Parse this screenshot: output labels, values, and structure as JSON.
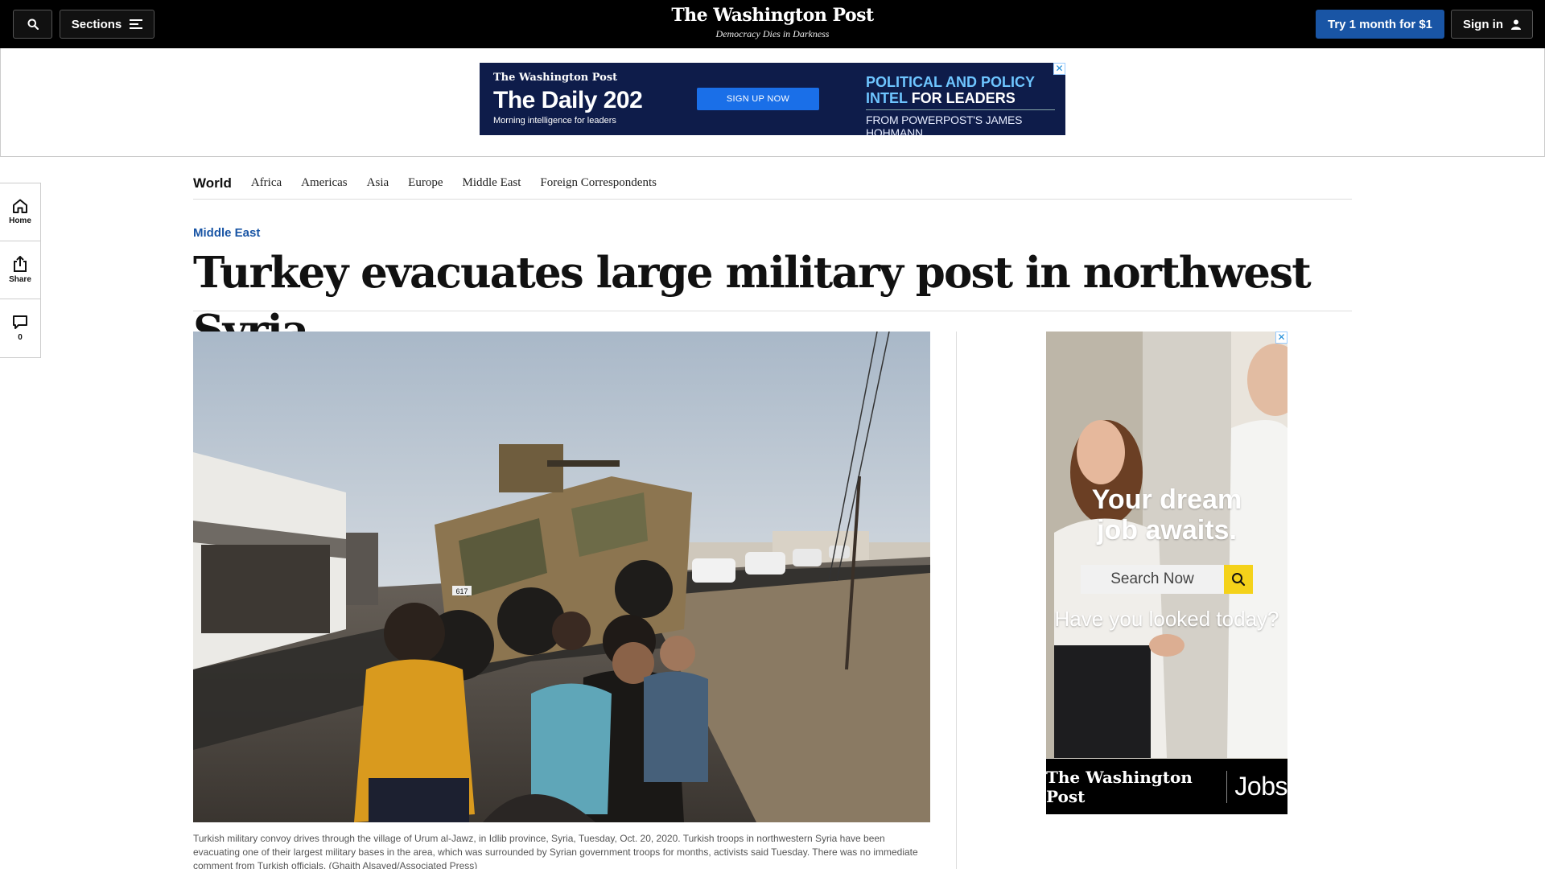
{
  "header": {
    "sections_label": "Sections",
    "logo": "The Washington Post",
    "tagline": "Democracy Dies in Darkness",
    "trial_label": "Try 1 month for $1",
    "signin_label": "Sign in"
  },
  "banner_ad": {
    "logo": "The Washington Post",
    "title": "The Daily 202",
    "subtitle": "Morning intelligence for leaders",
    "cta": "SIGN UP NOW",
    "headline_blue": "POLITICAL AND POLICY",
    "headline_line2_blue": "INTEL",
    "headline_line2_white": "FOR LEADERS",
    "from": "FROM POWERPOST'S JAMES HOHMANN"
  },
  "section_nav": {
    "title": "World",
    "links": [
      "Africa",
      "Americas",
      "Asia",
      "Europe",
      "Middle East",
      "Foreign Correspondents"
    ]
  },
  "rail": {
    "home": "Home",
    "share": "Share",
    "comments_count": "0"
  },
  "article": {
    "kicker": "Middle East",
    "headline": "Turkey evacuates large military post in northwest Syria",
    "photo_plate": "617",
    "caption": "Turkish military convoy drives through the village of Urum al-Jawz, in Idlib province, Syria, Tuesday, Oct. 20, 2020. Turkish troops in northwestern Syria have been evacuating one of their largest military bases in the area, which was surrounded by Syrian government troops for months, activists said Tuesday. There was no immediate comment from Turkish officials. (Ghaith Alsayed/Associated Press)"
  },
  "side_ad": {
    "headline_line1": "Your dream",
    "headline_line2": "job awaits.",
    "search_placeholder": "Search Now",
    "question": "Have you looked today?",
    "footer_logo": "The Washington Post",
    "footer_jobs": "Jobs"
  },
  "icons": [
    "search-icon",
    "menu-icon",
    "user-icon",
    "home-icon",
    "share-icon",
    "comment-icon",
    "adchoices-icon",
    "magnifier-icon"
  ],
  "colors": {
    "accent": "#1955a5",
    "topbar": "#000000",
    "banner_bg": "#0e1c4a",
    "banner_cta": "#1a6fe8",
    "search_yellow": "#f4d21a"
  }
}
